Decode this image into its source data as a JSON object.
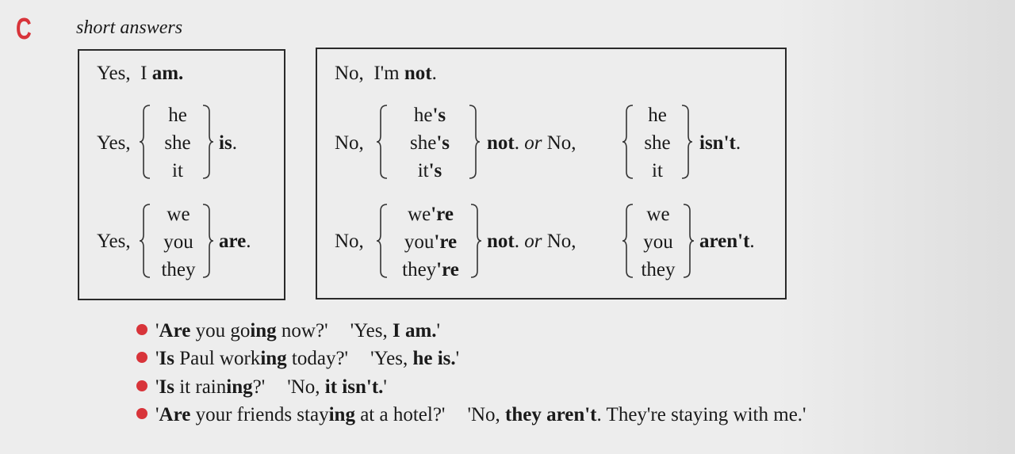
{
  "section": {
    "letter": "C",
    "title": "short answers"
  },
  "yes_box": {
    "row1": {
      "prefix": "Yes,",
      "pronoun": "I",
      "verb": "am."
    },
    "row2": {
      "prefix": "Yes,",
      "pronouns": [
        "he",
        "she",
        "it"
      ],
      "verb": "is",
      "end": "."
    },
    "row3": {
      "prefix": "Yes,",
      "pronouns": [
        "we",
        "you",
        "they"
      ],
      "verb": "are",
      "end": "."
    }
  },
  "no_box": {
    "row1": {
      "prefix": "No,",
      "contraction": "I'm",
      "neg": "not",
      "end": "."
    },
    "row2": {
      "prefix": "No,",
      "contractions": [
        {
          "base": "he",
          "suffix": "'s"
        },
        {
          "base": "she",
          "suffix": "'s"
        },
        {
          "base": "it",
          "suffix": "'s"
        }
      ],
      "neg": "not",
      "end": ".",
      "or": "or",
      "prefix2": "No,",
      "pronouns2": [
        "he",
        "she",
        "it"
      ],
      "neg2": "isn't",
      "end2": "."
    },
    "row3": {
      "prefix": "No,",
      "contractions": [
        {
          "base": "we",
          "suffix": "'re"
        },
        {
          "base": "you",
          "suffix": "'re"
        },
        {
          "base": "they",
          "suffix": "'re"
        }
      ],
      "neg": "not",
      "end": ".",
      "or": "or",
      "prefix2": "No,",
      "pronouns2": [
        "we",
        "you",
        "they"
      ],
      "neg2": "aren't",
      "end2": "."
    }
  },
  "examples": [
    {
      "q": [
        "'",
        "Are",
        " you go",
        "ing",
        " now?'"
      ],
      "a": [
        "'Yes, ",
        "I am.",
        "'"
      ]
    },
    {
      "q": [
        "'",
        "Is",
        " Paul work",
        "ing",
        " today?'"
      ],
      "a": [
        "'Yes, ",
        "he is.",
        "'"
      ]
    },
    {
      "q": [
        "'",
        "Is",
        " it rain",
        "ing",
        "?'"
      ],
      "a": [
        "'No, ",
        "it isn't.",
        "'"
      ]
    },
    {
      "q": [
        "'",
        "Are",
        " your friends stay",
        "ing",
        " at a hotel?'"
      ],
      "a": [
        "'No, ",
        "they aren't",
        ". They're staying with me.'"
      ]
    }
  ],
  "colors": {
    "accent": "#d8343a",
    "paper": "#ededed",
    "ink": "#1a1a1a"
  }
}
